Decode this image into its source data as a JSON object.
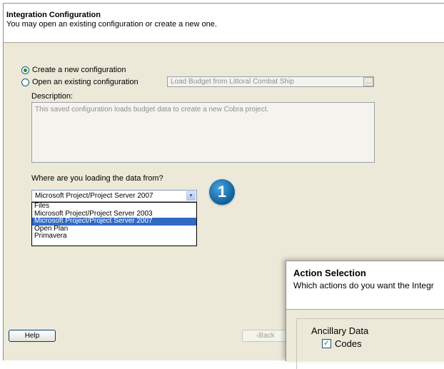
{
  "header": {
    "title": "Integration Configuration",
    "subtitle": "You may open an existing configuration or create a new one."
  },
  "options": {
    "create_label": "Create a new configuration",
    "open_label": "Open an existing configuration",
    "selected": "create"
  },
  "load_field": {
    "value": "Load Budget from Littoral Combat Ship",
    "browse_label": "..."
  },
  "description": {
    "label": "Description:",
    "text": "This saved configuration loads budget data to create a new Cobra project."
  },
  "source": {
    "question": "Where are you loading the data from?",
    "selected": "Microsoft Project/Project Server 2007",
    "options": [
      "Files",
      "Microsoft Project/Project Server 2003",
      "Microsoft Project/Project Server 2007",
      "Open Plan",
      "Primavera"
    ],
    "highlighted_index": 2
  },
  "callout": {
    "number": "1"
  },
  "footer": {
    "help_label": "Help",
    "back_label": "‹Back"
  },
  "overlay": {
    "title": "Action Selection",
    "subtitle": "Which actions do you want the Integr",
    "group_label": "Ancillary Data",
    "codes_label": "Codes",
    "codes_checked": true
  },
  "colors": {
    "selection": "#316ac5",
    "callout": "#0d5e9c",
    "dialog_bg": "#ece9d8"
  },
  "icons": {
    "radio_checked": "radio-checked-icon",
    "dropdown_arrow": "chevron-down-icon"
  }
}
